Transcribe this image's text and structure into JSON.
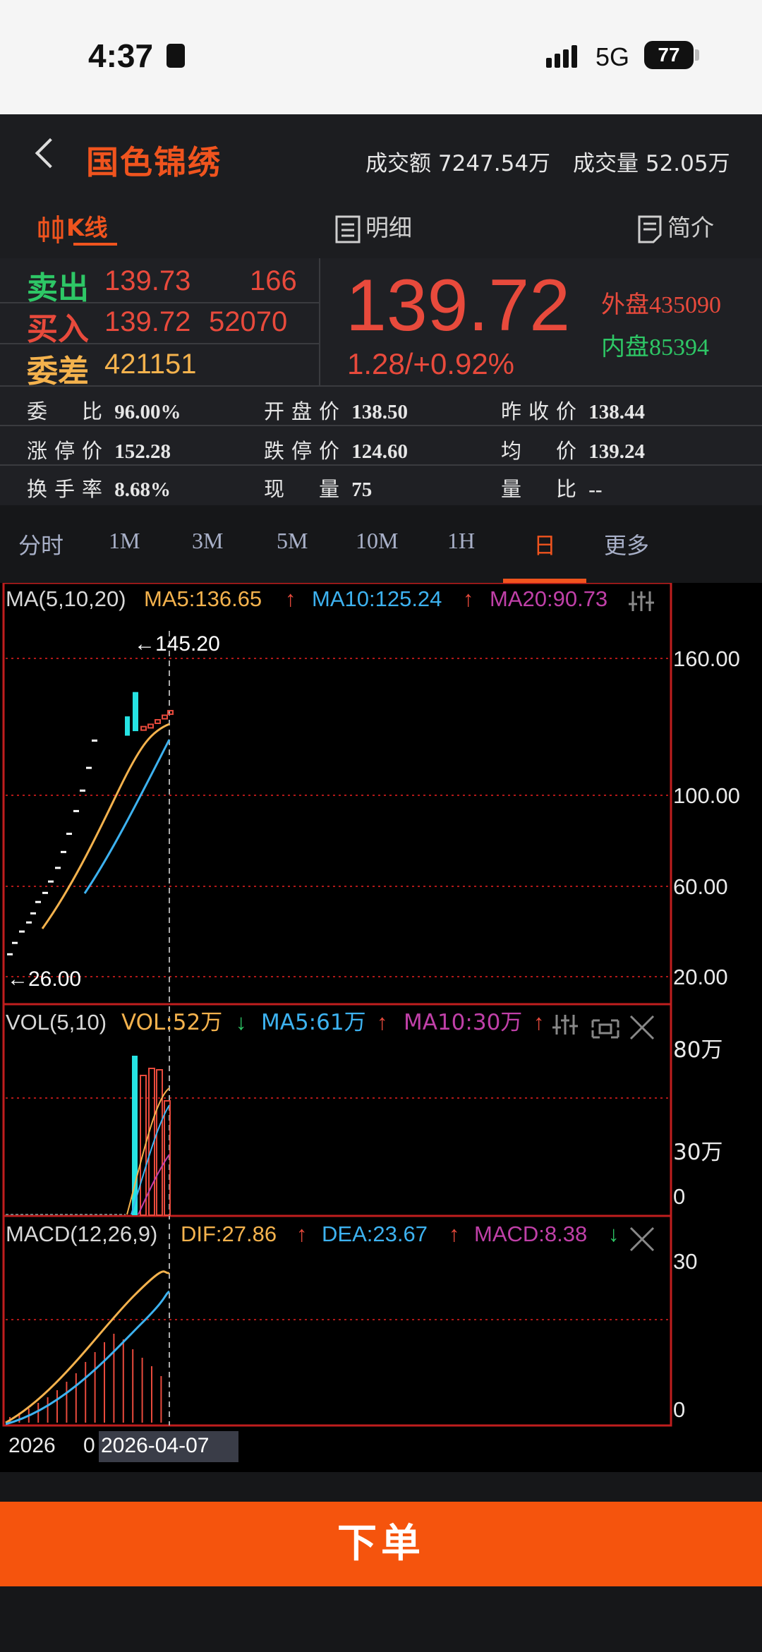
{
  "status_bar": {
    "time": "4:37",
    "network": "5G",
    "battery": "77"
  },
  "header": {
    "stock_name": "国色锦绣",
    "turnover_label": "成交额",
    "turnover_value": "7247.54万",
    "volume_label": "成交量",
    "volume_value": "52.05万"
  },
  "tabs": [
    {
      "label": "K线"
    },
    {
      "label": "明细"
    },
    {
      "label": "简介"
    }
  ],
  "order_book": {
    "sell_label": "卖出",
    "sell_price": "139.73",
    "sell_qty": "166",
    "buy_label": "买入",
    "buy_price": "139.72",
    "buy_qty": "52070",
    "diff_label": "委差",
    "diff_value": "421151"
  },
  "price": {
    "last": "139.72",
    "change": "1.28/+0.92%",
    "outer_label": "外盘",
    "outer_value": "435090",
    "inner_label": "内盘",
    "inner_value": "85394"
  },
  "stats": [
    {
      "label": "委　比",
      "value": "96.00%"
    },
    {
      "label": "开盘价",
      "value": "138.50"
    },
    {
      "label": "昨收价",
      "value": "138.44"
    },
    {
      "label": "涨停价",
      "value": "152.28"
    },
    {
      "label": "跌停价",
      "value": "124.60"
    },
    {
      "label": "均　价",
      "value": "139.24"
    },
    {
      "label": "换手率",
      "value": "8.68%"
    },
    {
      "label": "现　量",
      "value": "75"
    },
    {
      "label": "量　比",
      "value": "--"
    }
  ],
  "periods": [
    {
      "label": "分时"
    },
    {
      "label": "1M"
    },
    {
      "label": "3M"
    },
    {
      "label": "5M"
    },
    {
      "label": "10M"
    },
    {
      "label": "1H"
    },
    {
      "label": "日",
      "active": true
    },
    {
      "label": "更多"
    }
  ],
  "colors": {
    "up": "#e84a3c",
    "down": "#26e3e3",
    "accent": "#f0541e",
    "ma5": "#f4b24d",
    "ma10": "#3db2f0",
    "ma20": "#c040a8",
    "grid": "#b01818"
  },
  "kline": {
    "ma_title": "MA(5,10,20)",
    "ma5": "MA5:136.65",
    "ma10": "MA10:125.24",
    "ma20": "MA20:90.73",
    "axis": [
      "160.00",
      "100.00",
      "60.00",
      "20.00"
    ],
    "high_note": "←145.20",
    "low_note": "←26.00"
  },
  "vol": {
    "title": "VOL(5,10)",
    "vol": "VOL:52万",
    "ma5": "MA5:61万",
    "ma10": "MA10:30万",
    "axis": [
      "80万",
      "30万",
      "0"
    ]
  },
  "macd": {
    "title": "MACD(12,26,9)",
    "dif": "DIF:27.86",
    "dea": "DEA:23.67",
    "macd": "MACD:8.38",
    "axis": [
      "30",
      "0"
    ]
  },
  "x_axis": {
    "start": "2026",
    "mid": "0",
    "current_date": "2026-04-07"
  },
  "order_button": "下单"
}
